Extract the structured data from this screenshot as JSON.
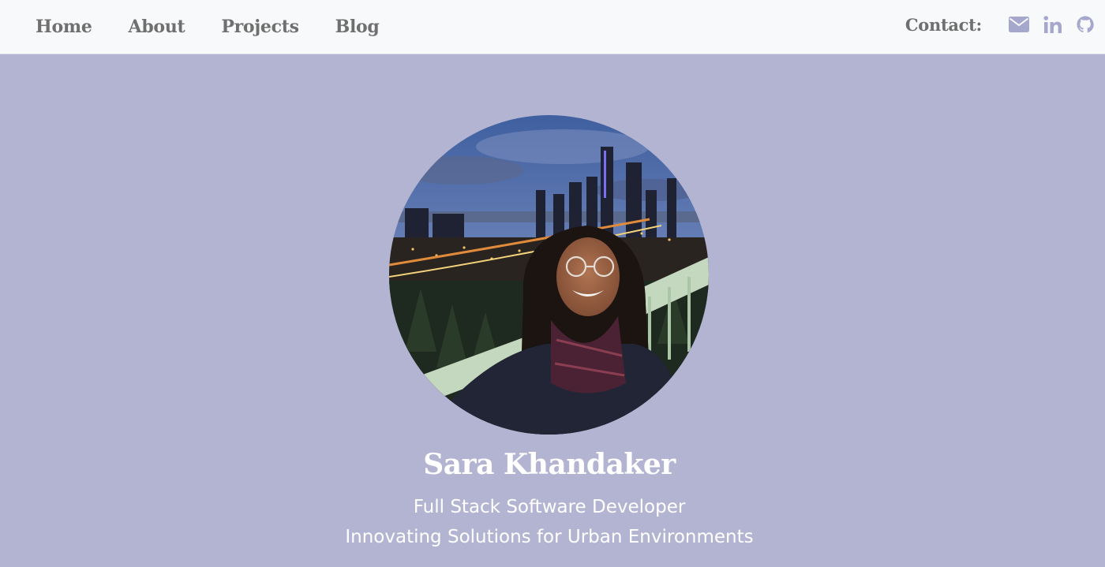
{
  "nav": {
    "links": [
      "Home",
      "About",
      "Projects",
      "Blog"
    ]
  },
  "contact": {
    "label": "Contact:",
    "icons": [
      "envelope-icon",
      "linkedin-icon",
      "github-icon"
    ],
    "icon_color": "#a6a7cc"
  },
  "hero": {
    "name": "Sara Khandaker",
    "tagline_1": "Full Stack Software Developer",
    "tagline_2": "Innovating Solutions for Urban Environments"
  },
  "colors": {
    "background": "#b3b4d1",
    "navbar": "#f8f9fa",
    "nav_text": "#6f6f6f",
    "hero_text": "#ffffff"
  }
}
